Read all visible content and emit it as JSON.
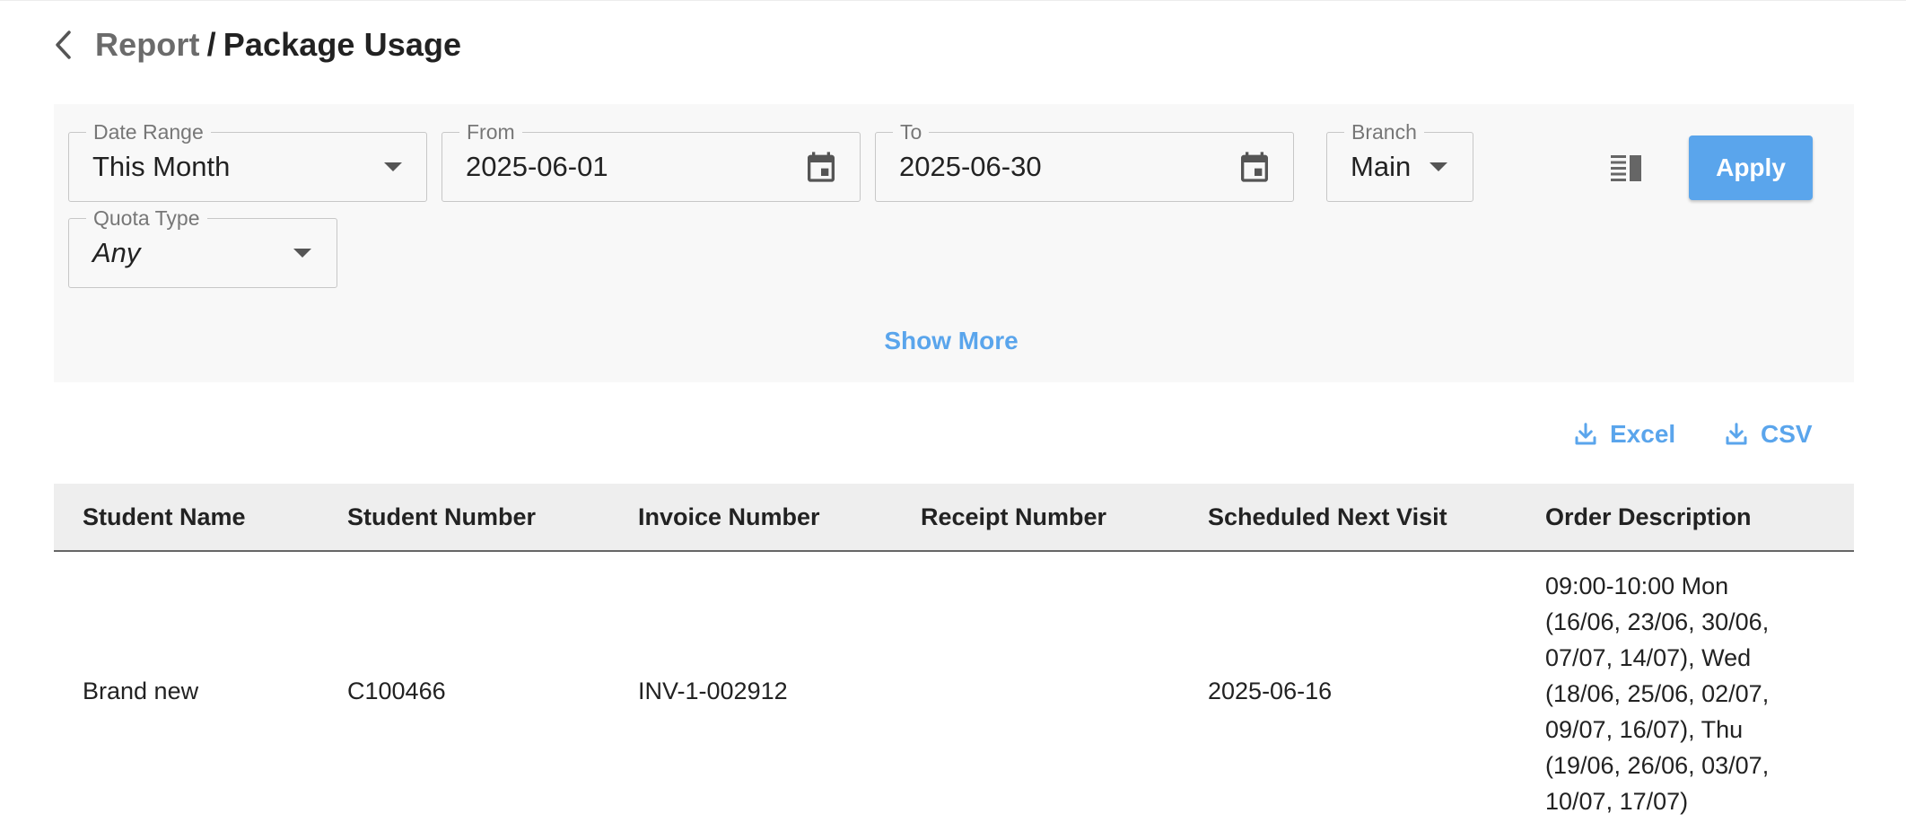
{
  "breadcrumb": {
    "parent": "Report",
    "separator": "/",
    "current": "Package Usage"
  },
  "filters": {
    "date_range": {
      "label": "Date Range",
      "value": "This Month"
    },
    "from": {
      "label": "From",
      "value": "2025-06-01"
    },
    "to": {
      "label": "To",
      "value": "2025-06-30"
    },
    "branch": {
      "label": "Branch",
      "value": "Main"
    },
    "quota_type": {
      "label": "Quota Type",
      "value": "Any"
    },
    "apply_label": "Apply",
    "show_more_label": "Show More"
  },
  "exports": {
    "excel_label": "Excel",
    "csv_label": "CSV"
  },
  "table": {
    "columns": [
      "Student Name",
      "Student Number",
      "Invoice Number",
      "Receipt Number",
      "Scheduled Next Visit",
      "Order Description"
    ],
    "rows": [
      {
        "student_name": "Brand new",
        "student_number": "C100466",
        "invoice_number": "INV-1-002912",
        "receipt_number": "",
        "scheduled_next_visit": "2025-06-16",
        "order_description": "09:00-10:00 Mon (16/06, 23/06, 30/06, 07/07, 14/07), Wed (18/06, 25/06, 02/07, 09/07, 16/07), Thu (19/06, 26/06, 03/07, 10/07, 17/07)"
      }
    ]
  },
  "icons": {
    "back": "chevron-left-icon",
    "calendar": "calendar-icon",
    "dropdown": "caret-down-icon",
    "columns": "view-columns-icon",
    "download": "download-icon"
  },
  "colors": {
    "accent": "#5aa5ec",
    "panel_bg": "#f8f8f8",
    "header_bg": "#eeeeee",
    "text": "#222222",
    "muted": "#6b6b6b"
  }
}
